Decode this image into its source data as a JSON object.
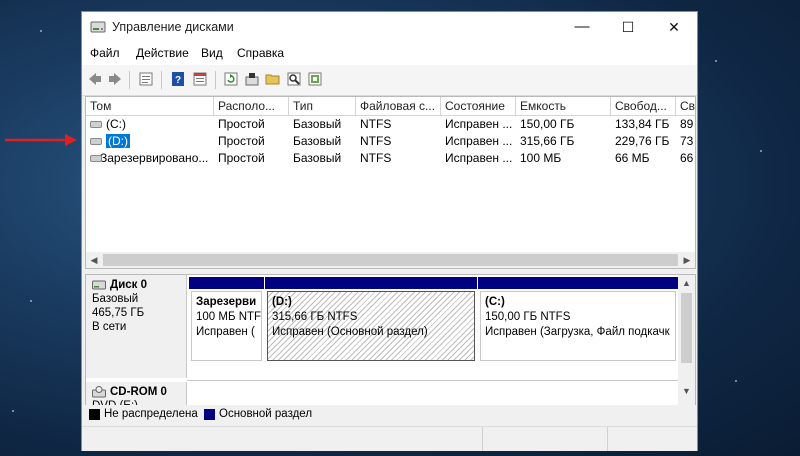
{
  "window": {
    "title": "Управление дисками",
    "minimize_glyph": "—",
    "maximize_glyph": "☐",
    "close_glyph": "✕"
  },
  "menu": [
    "Файл",
    "Действие",
    "Вид",
    "Справка"
  ],
  "toolbar_icons": [
    "back-icon",
    "forward-icon",
    "properties-icon",
    "help-icon",
    "list-view-icon",
    "refresh-icon",
    "disk-properties-icon",
    "open-folder-icon",
    "explore-icon",
    "rescan-icon"
  ],
  "volumes": {
    "columns": [
      "Том",
      "Располо...",
      "Тип",
      "Файловая с...",
      "Состояние",
      "Емкость",
      "Свобод...",
      "Св"
    ],
    "rows": [
      [
        "(C:)",
        "Простой",
        "Базовый",
        "NTFS",
        "Исправен ...",
        "150,00 ГБ",
        "133,84 ГБ",
        "89"
      ],
      [
        "(D:)",
        "Простой",
        "Базовый",
        "NTFS",
        "Исправен ...",
        "315,66 ГБ",
        "229,76 ГБ",
        "73"
      ],
      [
        "Зарезервировано...",
        "Простой",
        "Базовый",
        "NTFS",
        "Исправен ...",
        "100 МБ",
        "66 МБ",
        "66"
      ]
    ],
    "selected_row": 1
  },
  "disk0": {
    "name": "Диск 0",
    "type": "Базовый",
    "size": "465,75 ГБ",
    "status": "В сети",
    "partitions": [
      {
        "title": "Зарезерви",
        "size": "100 МБ NTFS",
        "status": "Исправен ("
      },
      {
        "title": "(D:)",
        "size": "315,66 ГБ NTFS",
        "status": "Исправен (Основной раздел)"
      },
      {
        "title": "(C:)",
        "size": "150,00 ГБ NTFS",
        "status": "Исправен (Загрузка, Файл подкачк"
      }
    ]
  },
  "cdrom0": {
    "name": "CD-ROM 0",
    "type": "DVD (E:)"
  },
  "legend": {
    "unallocated": "Не распределена",
    "primary": "Основной раздел"
  },
  "colors": {
    "primary_bar": "#000080",
    "unallocated": "#000000",
    "selection": "#0078d7",
    "annotation_arrow": "#e02020"
  }
}
